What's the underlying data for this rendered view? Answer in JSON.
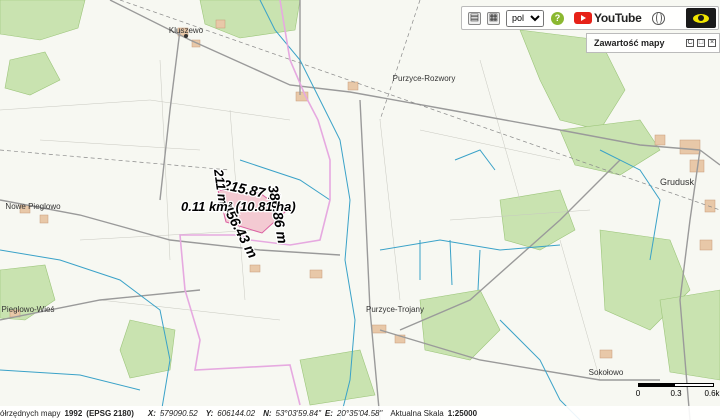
{
  "map": {
    "places": [
      {
        "id": "kluszewo",
        "label": "Kluszewo"
      },
      {
        "id": "purzyce-rozwory",
        "label": "Purzyce-Rozwory"
      },
      {
        "id": "grudusk",
        "label": "Grudusk"
      },
      {
        "id": "nowe-pieglowo",
        "label": "Nowe Pieglowo"
      },
      {
        "id": "purzyce-trojany",
        "label": "Purzyce-Trojany"
      },
      {
        "id": "pieglowo-wies",
        "label": "Pieglowo-Wieś"
      },
      {
        "id": "sokolowo",
        "label": "Sokołowo"
      }
    ],
    "measurement": {
      "area": "0.11 km² (10.81 ha)",
      "edges": [
        "215.87 m",
        "386.86 m",
        "456.43 m",
        "211 m"
      ]
    }
  },
  "toolbar": {
    "language": "pol",
    "language_options": [
      "pol"
    ],
    "help": "?",
    "youtube_label": "YouTube",
    "icons": [
      "print-icon",
      "save-icon",
      "language-select",
      "help-icon",
      "youtube-logo",
      "globe-icon",
      "eye-icon"
    ]
  },
  "panel": {
    "title": "Zawartość mapy",
    "buttons": [
      "C",
      "□",
      "×"
    ]
  },
  "status": {
    "coord_system_prefix": "ółrzędnych mapy",
    "coord_system_bold": "1992",
    "coord_system_epsg": "(EPSG 2180)",
    "x_label": "X:",
    "x_value": "579090.52",
    "y_label": "Y:",
    "y_value": "606144.02",
    "n_label": "N:",
    "n_value": "53°03'59.84\"",
    "e_label": "E:",
    "e_value": "20°35'04.58\"",
    "scale_label": "Aktualna Skala",
    "scale_value": "1:25000"
  },
  "scale_bar": {
    "ticks": [
      "0",
      "0.3",
      "0.6k"
    ]
  },
  "colors": {
    "map_background": "#f7f8f2",
    "forest": "#c9e3b0",
    "water": "#3aa2c8",
    "road": "#9a9a9a",
    "boundary": "#e6a9e0",
    "parcel": "#f3c6cf",
    "settlement": "#e8c8a8"
  }
}
